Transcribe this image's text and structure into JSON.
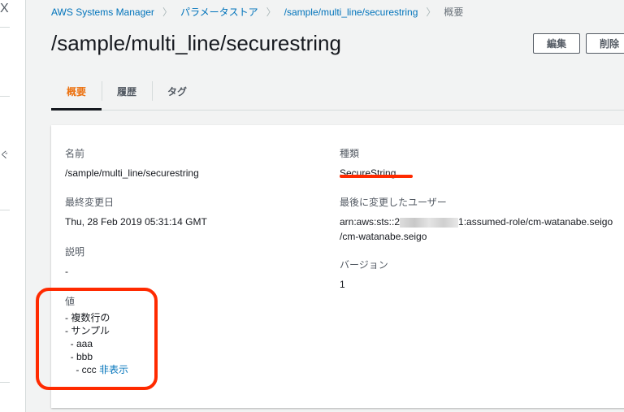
{
  "sidebar": {
    "close": "X",
    "fragment": "ぐ"
  },
  "breadcrumb": [
    "AWS Systems Manager",
    "パラメータストア",
    "/sample/multi_line/securestring",
    "概要"
  ],
  "title": "/sample/multi_line/securestring",
  "buttons": {
    "edit": "編集",
    "delete": "削除"
  },
  "tabs": [
    "概要",
    "履歴",
    "タグ"
  ],
  "details": {
    "name_label": "名前",
    "name": "/sample/multi_line/securestring",
    "modified_label": "最終変更日",
    "modified": "Thu, 28 Feb 2019 05:31:14 GMT",
    "desc_label": "説明",
    "desc": "-",
    "value_label": "値",
    "value_lines": [
      "- 複数行の",
      "- サンプル",
      "  - aaa",
      "  - bbb",
      "    - ccc"
    ],
    "hide_link": "非表示",
    "type_label": "種類",
    "type": "SecureString",
    "user_label": "最後に変更したユーザー",
    "user_prefix": "arn:aws:sts::2",
    "user_suffix": "1:assumed-role/cm-watanabe.seigo",
    "user_line2": "/cm-watanabe.seigo",
    "version_label": "バージョン",
    "version": "1"
  }
}
